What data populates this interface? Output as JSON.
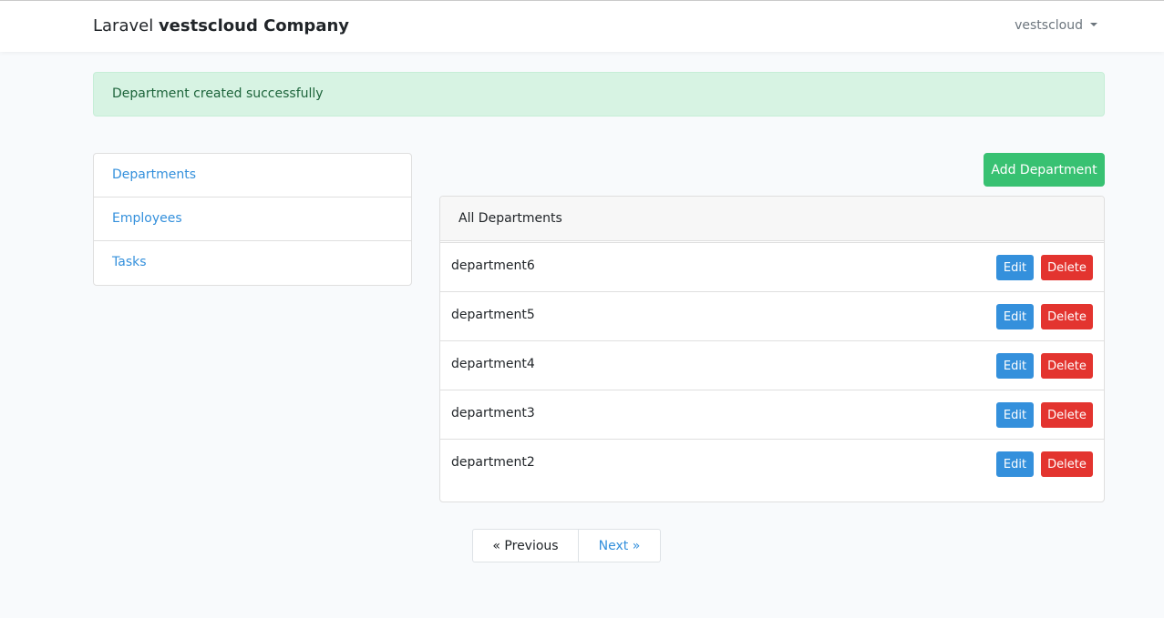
{
  "navbar": {
    "brand_prefix": "Laravel ",
    "brand_name": "vestscloud Company",
    "user_name": "vestscloud"
  },
  "alert": {
    "message": "Department created successfully",
    "color": "#d7f3e3"
  },
  "sidebar": {
    "items": [
      {
        "label": "Departments"
      },
      {
        "label": "Employees"
      },
      {
        "label": "Tasks"
      }
    ]
  },
  "main": {
    "add_button_label": "Add Department",
    "card_title": "All Departments",
    "departments": [
      {
        "name": "department6",
        "edit_label": "Edit",
        "delete_label": "Delete"
      },
      {
        "name": "department5",
        "edit_label": "Edit",
        "delete_label": "Delete"
      },
      {
        "name": "department4",
        "edit_label": "Edit",
        "delete_label": "Delete"
      },
      {
        "name": "department3",
        "edit_label": "Edit",
        "delete_label": "Delete"
      },
      {
        "name": "department2",
        "edit_label": "Edit",
        "delete_label": "Delete"
      }
    ]
  },
  "pagination": {
    "previous_label": "« Previous",
    "next_label": "Next »"
  },
  "colors": {
    "primary": "#3490dc",
    "success": "#38c172",
    "danger": "#e3342f"
  }
}
